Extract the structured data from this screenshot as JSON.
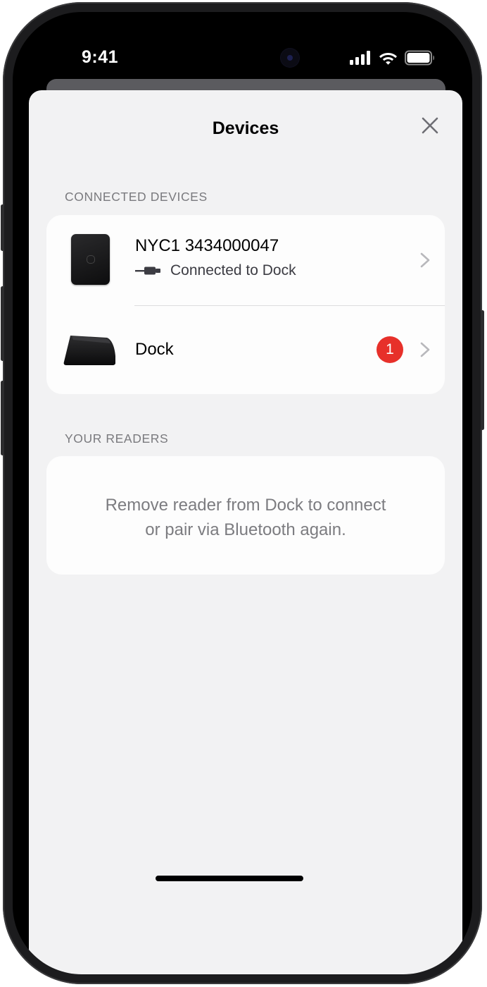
{
  "status_bar": {
    "time": "9:41",
    "icons": [
      "cellular-signal-icon",
      "wifi-icon",
      "battery-icon"
    ]
  },
  "sheet": {
    "title": "Devices",
    "close_icon": "close-icon"
  },
  "connected_devices": {
    "header": "CONNECTED DEVICES",
    "items": [
      {
        "title": "NYC1 3434000047",
        "subtitle": "Connected to Dock",
        "device_icon": "card-reader-icon",
        "status_icon": "usb-cable-icon"
      },
      {
        "title": "Dock",
        "badge": "1",
        "device_icon": "dock-icon"
      }
    ]
  },
  "your_readers": {
    "header": "YOUR READERS",
    "message_line1": "Remove reader from Dock to connect",
    "message_line2": "or pair via Bluetooth again."
  },
  "colors": {
    "sheet_background": "#f2f2f3",
    "card_background": "#fdfdfd",
    "badge": "#e7302a",
    "secondary_text": "#7c7c80"
  }
}
